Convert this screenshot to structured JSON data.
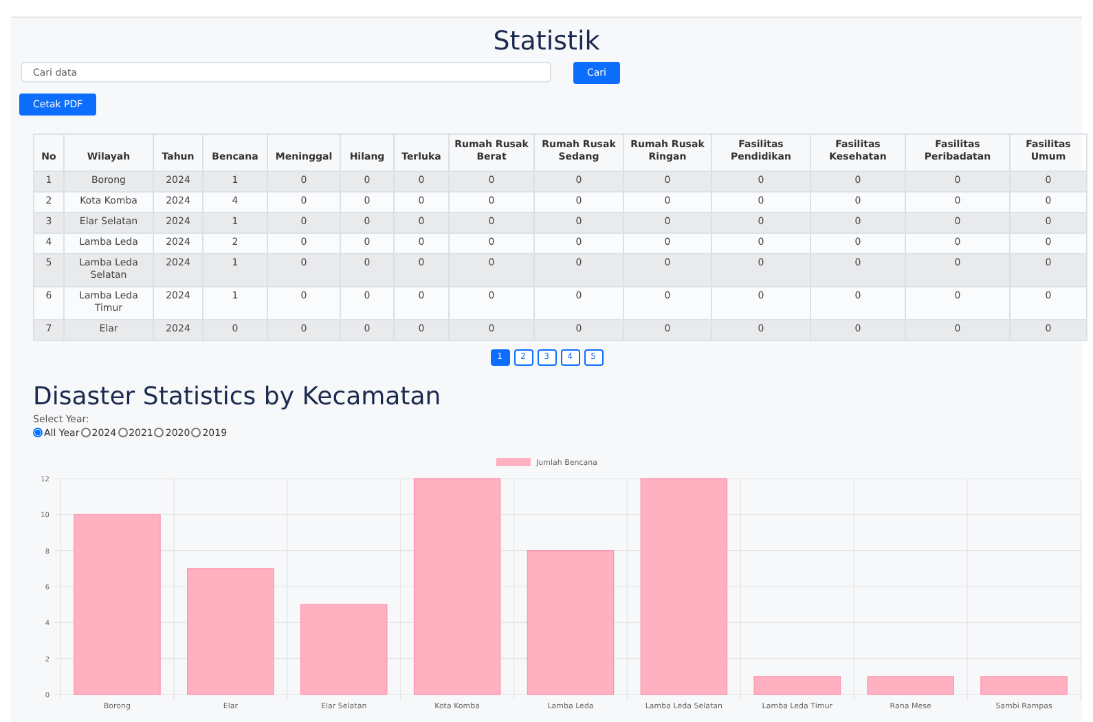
{
  "title": "Statistik",
  "search": {
    "placeholder": "Cari data",
    "button": "Cari"
  },
  "print_button": "Cetak PDF",
  "table": {
    "columns": [
      "No",
      "Wilayah",
      "Tahun",
      "Bencana",
      "Meninggal",
      "Hilang",
      "Terluka",
      "Rumah Rusak Berat",
      "Rumah Rusak Sedang",
      "Rumah Rusak Ringan",
      "Fasilitas Pendidikan",
      "Fasilitas Kesehatan",
      "Fasilitas Peribadatan",
      "Fasilitas Umum"
    ],
    "rows": [
      [
        "1",
        "Borong",
        "2024",
        "1",
        "0",
        "0",
        "0",
        "0",
        "0",
        "0",
        "0",
        "0",
        "0",
        "0"
      ],
      [
        "2",
        "Kota Komba",
        "2024",
        "4",
        "0",
        "0",
        "0",
        "0",
        "0",
        "0",
        "0",
        "0",
        "0",
        "0"
      ],
      [
        "3",
        "Elar Selatan",
        "2024",
        "1",
        "0",
        "0",
        "0",
        "0",
        "0",
        "0",
        "0",
        "0",
        "0",
        "0"
      ],
      [
        "4",
        "Lamba Leda",
        "2024",
        "2",
        "0",
        "0",
        "0",
        "0",
        "0",
        "0",
        "0",
        "0",
        "0",
        "0"
      ],
      [
        "5",
        "Lamba Leda Selatan",
        "2024",
        "1",
        "0",
        "0",
        "0",
        "0",
        "0",
        "0",
        "0",
        "0",
        "0",
        "0"
      ],
      [
        "6",
        "Lamba Leda Timur",
        "2024",
        "1",
        "0",
        "0",
        "0",
        "0",
        "0",
        "0",
        "0",
        "0",
        "0",
        "0"
      ],
      [
        "7",
        "Elar",
        "2024",
        "0",
        "0",
        "0",
        "0",
        "0",
        "0",
        "0",
        "0",
        "0",
        "0",
        "0"
      ]
    ]
  },
  "pagination": [
    {
      "label": "1",
      "selected": true
    },
    {
      "label": "2",
      "selected": false
    },
    {
      "label": "3",
      "selected": false
    },
    {
      "label": "4",
      "selected": false
    },
    {
      "label": "5",
      "selected": false
    }
  ],
  "chart_section": {
    "title": "Disaster Statistics by Kecamatan",
    "select_label": "Select Year:",
    "years": [
      {
        "label": "All Year",
        "selected": true
      },
      {
        "label": "2024",
        "selected": false
      },
      {
        "label": "2021",
        "selected": false
      },
      {
        "label": "2020",
        "selected": false
      },
      {
        "label": "2019",
        "selected": false
      }
    ],
    "chart_data": {
      "type": "bar",
      "categories": [
        "Borong",
        "Elar",
        "Elar Selatan",
        "Kota Komba",
        "Lamba Leda",
        "Lamba Leda Selatan",
        "Lamba Leda Timur",
        "Rana Mese",
        "Sambi Rampas"
      ],
      "series": [
        {
          "name": "Jumlah Bencana",
          "color": "#ffb1c1",
          "values": [
            10,
            7,
            5,
            12,
            8,
            12,
            1,
            1,
            1
          ]
        }
      ],
      "grid": true,
      "ylim": [
        0,
        12
      ],
      "yticks": [
        0,
        2,
        4,
        6,
        8,
        10,
        12
      ]
    }
  }
}
